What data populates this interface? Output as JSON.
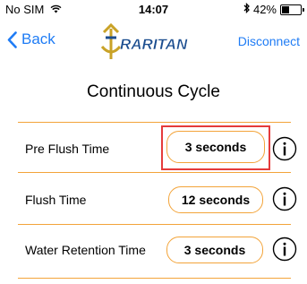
{
  "status_bar": {
    "carrier": "No SIM",
    "time": "14:07",
    "battery_percent_label": "42%",
    "battery_level": 0.42
  },
  "nav": {
    "back_label": "Back",
    "logo_text": "RARITAN",
    "disconnect_label": "Disconnect"
  },
  "screen": {
    "title": "Continuous Cycle"
  },
  "settings": [
    {
      "label": "Pre Flush Time",
      "value": "3 seconds",
      "highlighted": true
    },
    {
      "label": "Flush Time",
      "value": "12 seconds",
      "highlighted": false
    },
    {
      "label": "Water Retention Time",
      "value": "3 seconds",
      "highlighted": false
    }
  ],
  "colors": {
    "accent_blue": "#1f7cf5",
    "divider_orange": "#f3a43a",
    "highlight_red": "#e53b3b"
  },
  "icons": {
    "wifi": "wifi-icon",
    "bluetooth": "bluetooth-icon",
    "battery": "battery-icon",
    "back": "chevron-left-icon",
    "info": "info-icon"
  }
}
